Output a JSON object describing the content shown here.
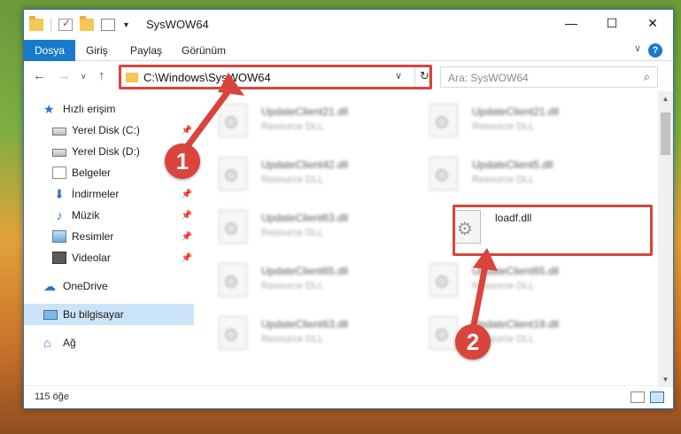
{
  "window": {
    "title": "SysWOW64",
    "controls": {
      "minimize": "—",
      "maximize": "☐",
      "close": "✕"
    }
  },
  "ribbon": {
    "tabs": [
      {
        "label": "Dosya"
      },
      {
        "label": "Giriş"
      },
      {
        "label": "Paylaş"
      },
      {
        "label": "Görünüm"
      }
    ],
    "help": "?"
  },
  "address": {
    "path": "C:\\Windows\\SysWOW64",
    "search_placeholder": "Ara: SysWOW64"
  },
  "sidebar": {
    "items": [
      {
        "label": "Hızlı erişim",
        "icon": "star-icon"
      },
      {
        "label": "Yerel Disk (C:)",
        "icon": "disk-icon"
      },
      {
        "label": "Yerel Disk (D:)",
        "icon": "disk-icon"
      },
      {
        "label": "Belgeler",
        "icon": "document-icon"
      },
      {
        "label": "İndirmeler",
        "icon": "download-icon"
      },
      {
        "label": "Müzik",
        "icon": "music-icon"
      },
      {
        "label": "Resimler",
        "icon": "picture-icon"
      },
      {
        "label": "Videolar",
        "icon": "video-icon"
      },
      {
        "label": "OneDrive",
        "icon": "cloud-icon"
      },
      {
        "label": "Bu bilgisayar",
        "icon": "computer-icon"
      },
      {
        "label": "Ağ",
        "icon": "network-icon"
      }
    ]
  },
  "files": [
    {
      "name": "UpdateClient21.dll",
      "type": "Resource DLL"
    },
    {
      "name": "UpdateClient21.dll",
      "type": "Resource DLL"
    },
    {
      "name": "UpdateClient42.dll",
      "type": "Resource DLL"
    },
    {
      "name": "UpdateClient5.dll",
      "type": "Resource DLL"
    },
    {
      "name": "UpdateClient63.dll",
      "type": "Resource DLL"
    },
    {
      "name": "loadf.dll",
      "type": ""
    },
    {
      "name": "UpdateClient65.dll",
      "type": "Resource DLL"
    },
    {
      "name": "UpdateClient65.dll",
      "type": "Resource DLL"
    },
    {
      "name": "UpdateClient63.dll",
      "type": "Resource DLL"
    },
    {
      "name": "UpdateClient19.dll",
      "type": "Resource DLL"
    }
  ],
  "status": {
    "count": "115 öğe"
  },
  "callouts": {
    "one": "1",
    "two": "2"
  },
  "colors": {
    "accent": "#1979ca",
    "highlight": "#d9443d",
    "selected": "#cce4f7"
  }
}
